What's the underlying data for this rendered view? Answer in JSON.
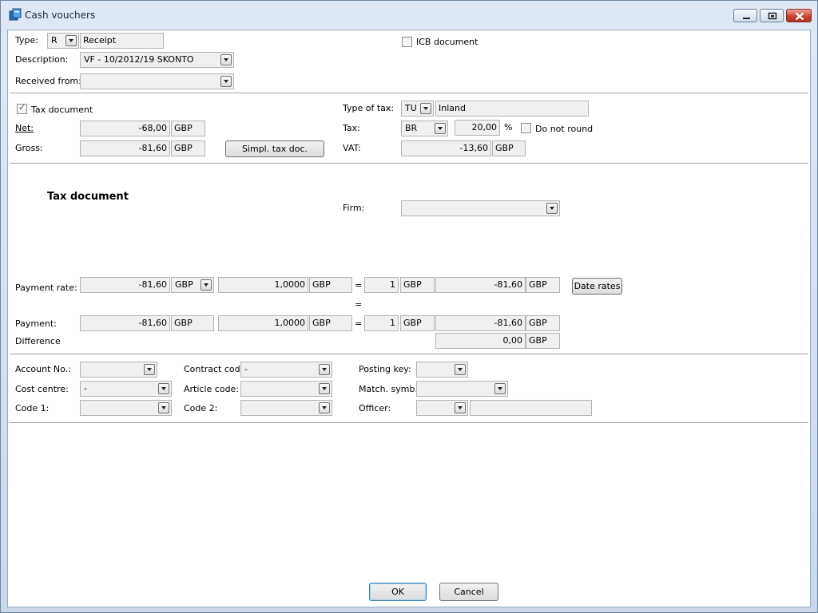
{
  "window": {
    "title": "Cash vouchers"
  },
  "header": {
    "type_label": "Type:",
    "type_code": "R",
    "type_name": "Receipt",
    "icb_label": "ICB document",
    "description_label": "Description:",
    "description_value": "VF - 10/2012/19 SKONTO",
    "received_from_label": "Received from:",
    "received_from_value": ""
  },
  "tax": {
    "tax_document_label": "Tax document",
    "net_label": "Net:",
    "net_value": "-68,00",
    "net_currency": "GBP",
    "gross_label": "Gross:",
    "gross_value": "-81,60",
    "gross_currency": "GBP",
    "simpl_button": "Simpl. tax doc.",
    "type_of_tax_label": "Type of tax:",
    "type_of_tax_code": "TU",
    "type_of_tax_name": "Inland",
    "tax_label": "Tax:",
    "tax_code": "BR",
    "tax_rate": "20,00",
    "percent": "%",
    "do_not_round_label": "Do not round",
    "vat_label": "VAT:",
    "vat_value": "-13,60",
    "vat_currency": "GBP"
  },
  "taxdoc": {
    "heading": "Tax document",
    "firm_label": "Firm:",
    "firm_value": ""
  },
  "payment": {
    "rate_label": "Payment rate:",
    "rate_amount": "-81,60",
    "rate_currency": "GBP",
    "rate_value": "1,0000",
    "rate_value_currency": "GBP",
    "equals": "=",
    "rate_units": "1",
    "rate_units_currency": "GBP",
    "rate_result": "-81,60",
    "rate_result_currency": "GBP",
    "date_rates_button": "Date rates",
    "middle_equals": "=",
    "payment_label": "Payment:",
    "payment_amount": "-81,60",
    "payment_currency": "GBP",
    "payment_rate": "1,0000",
    "payment_rate_currency": "GBP",
    "payment_equals": "=",
    "payment_units": "1",
    "payment_units_currency": "GBP",
    "payment_result": "-81,60",
    "payment_result_currency": "GBP",
    "difference_label": "Difference",
    "difference_value": "0,00",
    "difference_currency": "GBP"
  },
  "accounting": {
    "account_no_label": "Account No.:",
    "account_no_value": "",
    "contract_code_label": "Contract code:",
    "contract_code_value": "-",
    "posting_key_label": "Posting key:",
    "posting_key_value": "",
    "cost_centre_label": "Cost centre:",
    "cost_centre_value": "-",
    "article_code_label": "Article code:",
    "article_code_value": "",
    "match_symb_label": "Match. symb.:",
    "match_symb_value": "",
    "code1_label": "Code 1:",
    "code1_value": "",
    "code2_label": "Code 2:",
    "code2_value": "",
    "officer_label": "Officer:",
    "officer_code": "",
    "officer_name": ""
  },
  "footer": {
    "ok_label": "OK",
    "cancel_label": "Cancel"
  }
}
